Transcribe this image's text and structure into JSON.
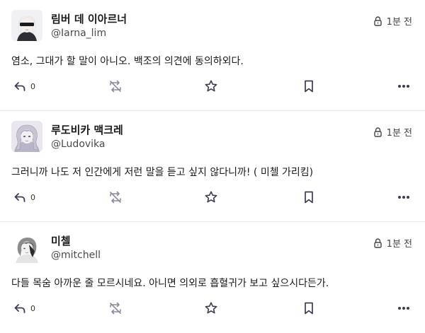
{
  "posts": [
    {
      "display_name": "림버 데 이아르너",
      "handle": "@Iarna_lim",
      "time": "1분 전",
      "content": "염소, 그대가 할 말이 아니오. 백조의 의견에 동의하외다.",
      "reply_count": "0",
      "avatar_icon": "white-haired-blindfold-portrait",
      "visibility_icon": "lock-icon"
    },
    {
      "display_name": "루도비카 맥크레",
      "handle": "@Ludovika",
      "time": "1분 전",
      "content": "그러니까 나도 저 인간에게 저런 말을 듣고 싶지 않다니까! ( 미첼 가리킴)",
      "reply_count": "0",
      "avatar_icon": "silver-haired-portrait",
      "visibility_icon": "lock-icon"
    },
    {
      "display_name": "미첼",
      "handle": "@mitchell",
      "time": "1분 전",
      "content": "다들 목숨 아까운 줄 모르시네요. 아니면 의외로 흡혈귀가 보고 싶으시다든가.",
      "reply_count": "0",
      "avatar_icon": "grey-haired-sketch-portrait",
      "visibility_icon": "lock-icon"
    }
  ],
  "colors": {
    "text": "#1a1a1a",
    "muted": "#444444",
    "icon": "#3c3c52",
    "boost_disabled": "#8a8aa0",
    "divider": "#e6e6e6"
  }
}
